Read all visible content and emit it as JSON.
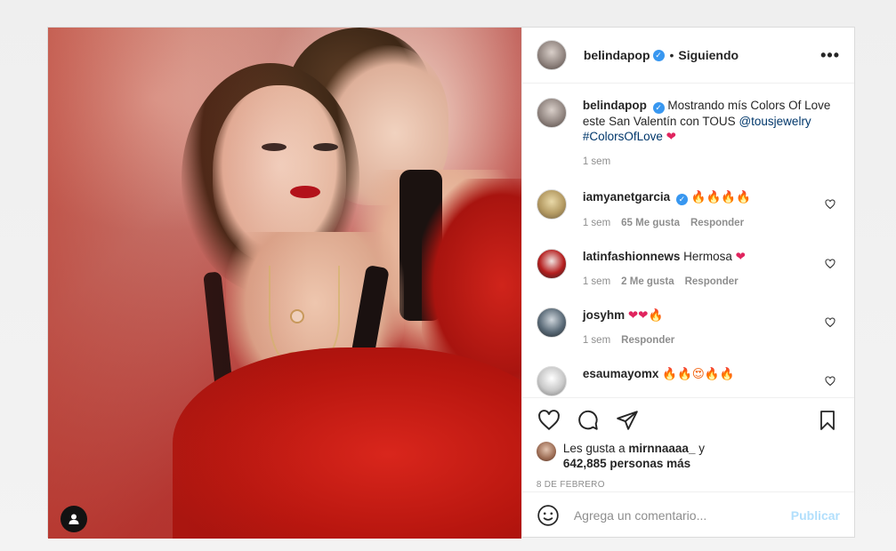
{
  "header": {
    "username": "belindapop",
    "separator": "•",
    "follow_status": "Siguiendo",
    "more_label": "•••"
  },
  "caption": {
    "username": "belindapop",
    "text": "Mostrando mís Colors Of Love este San Valentín con TOUS",
    "mention": "@tousjewelry",
    "hashtag": "#ColorsOfLove",
    "emoji": "❤",
    "time": "1 sem"
  },
  "comments": [
    {
      "username": "iamyanetgarcia",
      "verified": true,
      "text": "🔥🔥🔥🔥",
      "time": "1 sem",
      "likes": "65 Me gusta",
      "reply": "Responder"
    },
    {
      "username": "latinfashionnews",
      "verified": false,
      "text": "Hermosa",
      "emoji": "❤",
      "time": "1 sem",
      "likes": "2 Me gusta",
      "reply": "Responder"
    },
    {
      "username": "josyhm",
      "verified": false,
      "text": "❤❤🔥",
      "time": "1 sem",
      "likes": "",
      "reply": "Responder"
    },
    {
      "username": "esaumayomx",
      "verified": false,
      "text": "🔥🔥😍🔥🔥",
      "time": "",
      "likes": "",
      "reply": ""
    }
  ],
  "likes": {
    "prefix": "Les gusta a",
    "user": "mirnnaaaa_",
    "joiner": "y",
    "count": "642,885 personas más"
  },
  "date": "8 DE FEBRERO",
  "add_comment": {
    "placeholder": "Agrega un comentario...",
    "publish_label": "Publicar"
  }
}
